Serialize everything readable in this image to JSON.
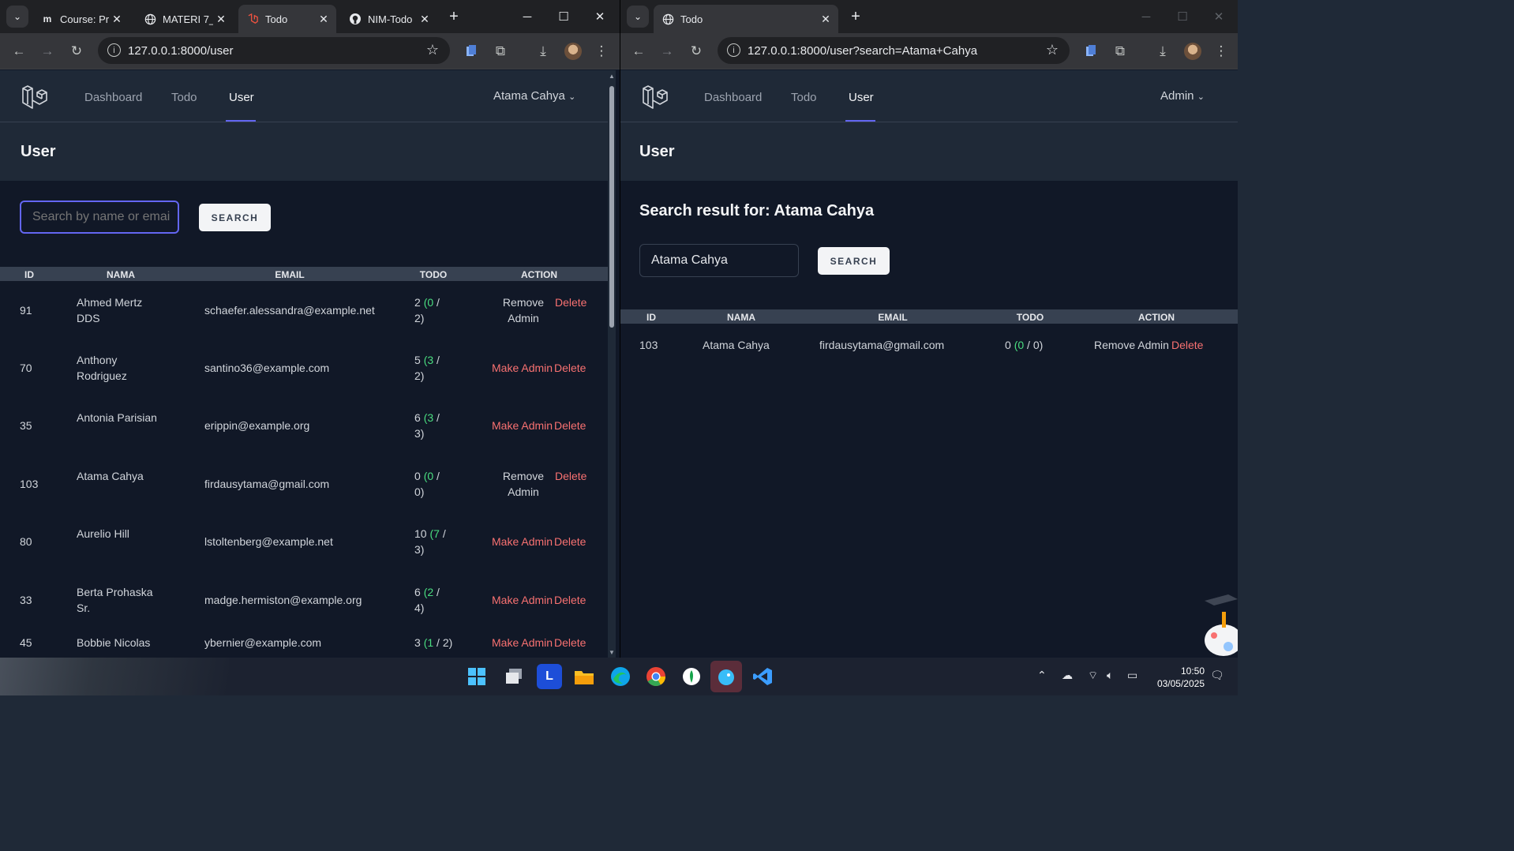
{
  "left_window": {
    "tabs": [
      {
        "title": "Course: Pr",
        "icon": "moodle-icon"
      },
      {
        "title": "MATERI 7_",
        "icon": "globe-icon"
      },
      {
        "title": "Todo",
        "icon": "laravel-icon"
      },
      {
        "title": "NIM-Todo",
        "icon": "github-icon"
      }
    ],
    "url": "127.0.0.1:8000/user",
    "nav": {
      "links": [
        "Dashboard",
        "Todo",
        "User"
      ],
      "user": "Atama Cahya"
    },
    "page_title": "User",
    "search": {
      "placeholder": "Search by name or emai",
      "button": "SEARCH"
    },
    "table": {
      "headers": [
        "ID",
        "NAMA",
        "EMAIL",
        "TODO",
        "ACTION"
      ],
      "rows": [
        {
          "id": "91",
          "name": "Ahmed Mertz DDS",
          "email": "schaefer.alessandra@example.net",
          "todo_total": "2",
          "todo_done": "0",
          "todo_pending": "2",
          "action": "Remove Admin",
          "delete": "Delete"
        },
        {
          "id": "70",
          "name": "Anthony Rodriguez",
          "email": "santino36@example.com",
          "todo_total": "5",
          "todo_done": "3",
          "todo_pending": "2",
          "action": "Make Admin",
          "delete": "Delete"
        },
        {
          "id": "35",
          "name": "Antonia Parisian",
          "email": "erippin@example.org",
          "todo_total": "6",
          "todo_done": "3",
          "todo_pending": "3",
          "action": "Make Admin",
          "delete": "Delete"
        },
        {
          "id": "103",
          "name": "Atama Cahya",
          "email": "firdausytama@gmail.com",
          "todo_total": "0",
          "todo_done": "0",
          "todo_pending": "0",
          "action": "Remove Admin",
          "delete": "Delete"
        },
        {
          "id": "80",
          "name": "Aurelio Hill",
          "email": "lstoltenberg@example.net",
          "todo_total": "10",
          "todo_done": "7",
          "todo_pending": "3",
          "action": "Make Admin",
          "delete": "Delete"
        },
        {
          "id": "33",
          "name": "Berta Prohaska Sr.",
          "email": "madge.hermiston@example.org",
          "todo_total": "6",
          "todo_done": "2",
          "todo_pending": "4",
          "action": "Make Admin",
          "delete": "Delete"
        },
        {
          "id": "45",
          "name": "Bobbie Nicolas",
          "email": "ybernier@example.com",
          "todo_total": "3",
          "todo_done": "1",
          "todo_pending": "2",
          "action": "Make Admin",
          "delete": "Delete"
        }
      ]
    }
  },
  "right_window": {
    "tabs": [
      {
        "title": "Todo",
        "icon": "globe-icon"
      }
    ],
    "url": "127.0.0.1:8000/user?search=Atama+Cahya",
    "nav": {
      "links": [
        "Dashboard",
        "Todo",
        "User"
      ],
      "user": "Admin"
    },
    "page_title": "User",
    "result_heading": "Search result for: Atama Cahya",
    "search": {
      "value": "Atama Cahya",
      "button": "SEARCH"
    },
    "table": {
      "headers": [
        "ID",
        "NAMA",
        "EMAIL",
        "TODO",
        "ACTION"
      ],
      "rows": [
        {
          "id": "103",
          "name": "Atama Cahya",
          "email": "firdausytama@gmail.com",
          "todo_total": "0",
          "todo_done": "0",
          "todo_pending": "0",
          "action": "Remove Admin",
          "delete": "Delete"
        }
      ]
    }
  },
  "taskbar": {
    "time": "10:50",
    "date": "03/05/2025"
  },
  "colors": {
    "accent": "#6366f1",
    "danger": "#f87171",
    "success": "#4ade80",
    "bg": "#111827",
    "panel": "#1f2937"
  }
}
